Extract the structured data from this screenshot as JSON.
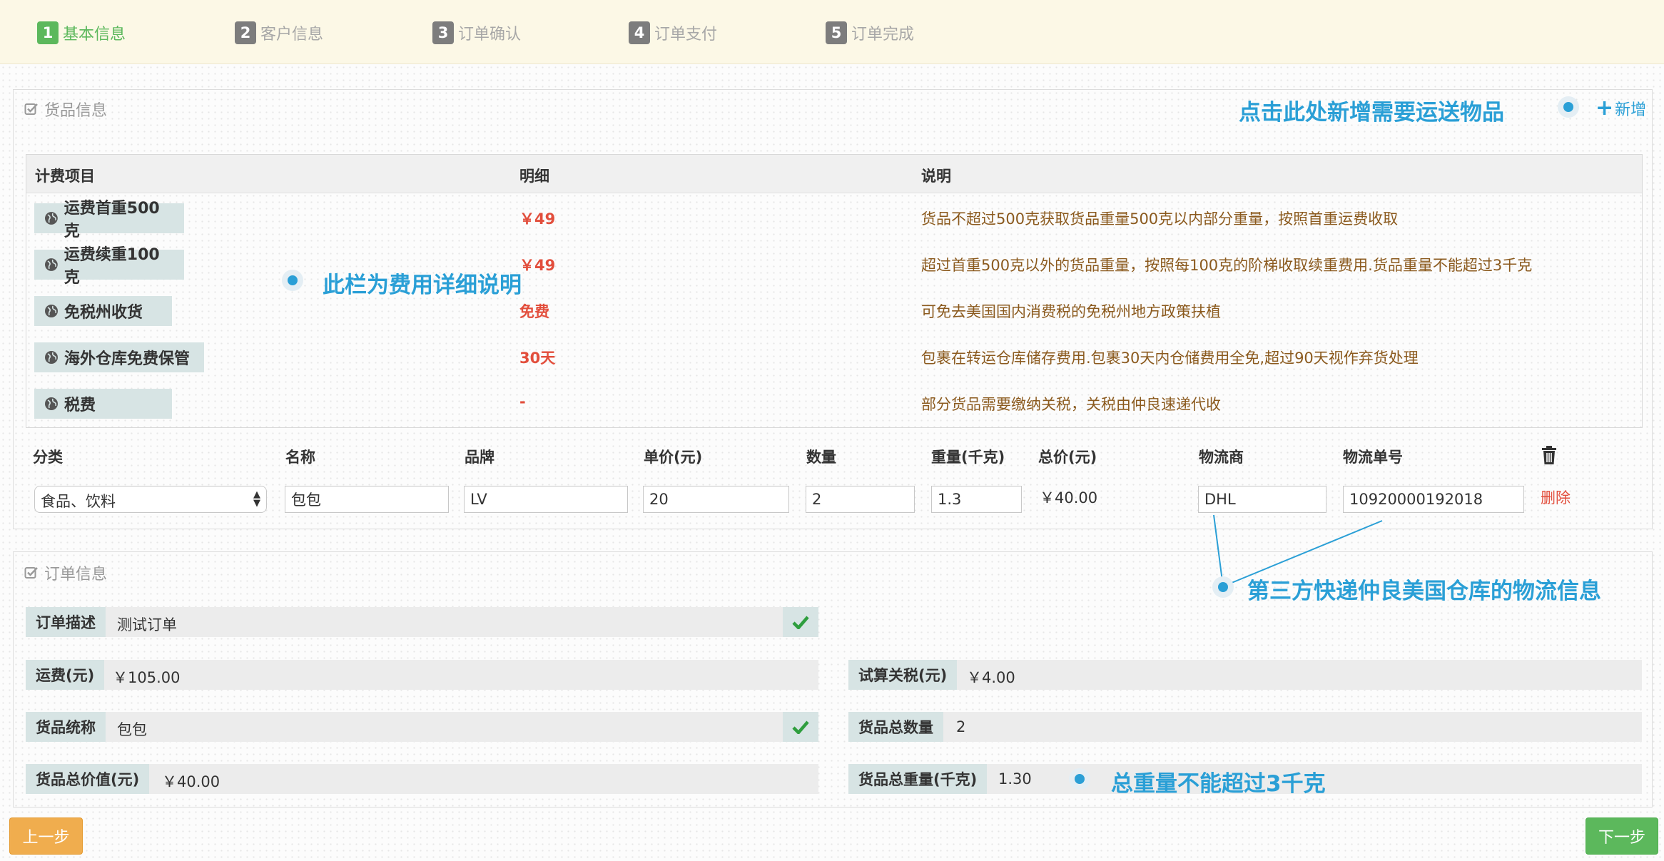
{
  "steps": [
    {
      "num": "1",
      "label": "基本信息"
    },
    {
      "num": "2",
      "label": "客户信息"
    },
    {
      "num": "3",
      "label": "订单确认"
    },
    {
      "num": "4",
      "label": "订单支付"
    },
    {
      "num": "5",
      "label": "订单完成"
    }
  ],
  "active_step": 1,
  "goods_panel": {
    "title": "货品信息",
    "add_label": "新增",
    "fee_table": {
      "headers": [
        "计费项目",
        "明细",
        "说明"
      ],
      "rows": [
        {
          "item": "运费首重500克",
          "detail": "￥49",
          "desc": "货品不超过500克获取货品重量500克以内部分重量，按照首重运费收取"
        },
        {
          "item": "运费续重100克",
          "detail": "￥49",
          "desc": "超过首重500克以外的货品重量，按照每100克的阶梯收取续重费用.货品重量不能超过3千克"
        },
        {
          "item": "免税州收货",
          "detail": "免费",
          "desc": "可免去美国国内消费税的免税州地方政策扶植"
        },
        {
          "item": "海外仓库免费保管",
          "detail": "30天",
          "desc": "包裹在转运仓库储存费用.包裹30天内仓储费用全免,超过90天视作弃货处理"
        },
        {
          "item": "税费",
          "detail": "-",
          "desc": "部分货品需要缴纳关税，关税由仲良速递代收"
        }
      ]
    },
    "goods_headers": [
      "分类",
      "名称",
      "品牌",
      "单价(元)",
      "数量",
      "重量(千克)",
      "总价(元)",
      "物流商",
      "物流单号"
    ],
    "goods_row": {
      "category": "食品、饮料",
      "name": "包包",
      "brand": "LV",
      "unit_price": "20",
      "quantity": "2",
      "weight": "1.3",
      "total": "￥40.00",
      "carrier": "DHL",
      "tracking": "10920000192018",
      "delete_label": "删除"
    }
  },
  "order_panel": {
    "title": "订单信息",
    "description": {
      "label": "订单描述",
      "value": "测试订单"
    },
    "freight": {
      "label": "运费(元)",
      "value": "￥105.00"
    },
    "tax": {
      "label": "试算关税(元)",
      "value": "￥4.00"
    },
    "goods_name": {
      "label": "货品统称",
      "value": "包包"
    },
    "goods_count": {
      "label": "货品总数量",
      "value": "2"
    },
    "goods_value": {
      "label": "货品总价值(元)",
      "value": "￥40.00"
    },
    "goods_weight": {
      "label": "货品总重量(千克)",
      "value": "1.30"
    }
  },
  "annotations": {
    "add_hint": "点击此处新增需要运送物品",
    "fee_hint": "此栏为费用详细说明",
    "logistics_hint": "第三方快递仲良美国仓库的物流信息",
    "weight_hint": "总重量不能超过3千克"
  },
  "buttons": {
    "prev": "上一步",
    "next": "下一步"
  },
  "colors": {
    "accent_blue": "#2a9fd6",
    "active_green": "#5cb85c",
    "price_red": "#e24e3c",
    "desc_brown": "#8b5a1e",
    "prev_orange": "#f0ad4e"
  }
}
